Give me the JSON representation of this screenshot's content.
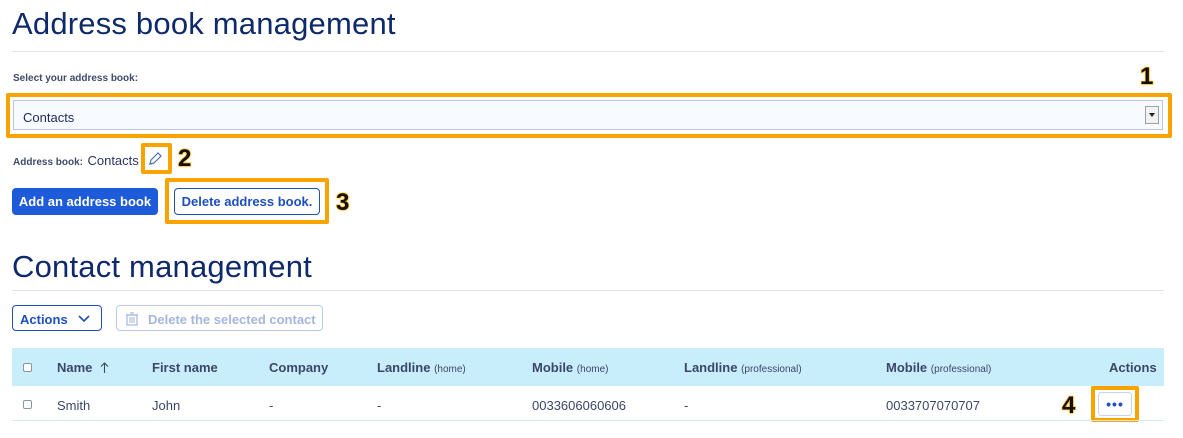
{
  "page": {
    "title": "Address book management",
    "select_label": "Select your address book:",
    "selected_book": "Contacts",
    "address_book_label": "Address book:",
    "address_book_name": "Contacts",
    "add_button": "Add an address book",
    "delete_button": "Delete address book."
  },
  "contacts": {
    "title": "Contact management",
    "actions_button": "Actions",
    "delete_selected_button": "Delete the selected contact",
    "columns": {
      "name": "Name",
      "first_name": "First name",
      "company": "Company",
      "landline_home": "Landline",
      "landline_home_sub": "(home)",
      "mobile_home": "Mobile",
      "mobile_home_sub": "(home)",
      "landline_pro": "Landline",
      "landline_pro_sub": "(professional)",
      "mobile_pro": "Mobile",
      "mobile_pro_sub": "(professional)",
      "actions": "Actions"
    },
    "rows": [
      {
        "name": "Smith",
        "first_name": "John",
        "company": "-",
        "landline_home": "-",
        "mobile_home": "0033606060606",
        "landline_pro": "-",
        "mobile_pro": "0033707070707",
        "more": "•••"
      }
    ]
  },
  "callouts": [
    "1",
    "2",
    "3",
    "4"
  ],
  "colors": {
    "primary": "#1e5bd8",
    "highlight": "#f7a300",
    "table_header": "#c9eefb",
    "heading": "#0f2a6b"
  },
  "icons": {
    "edit": "pencil-icon",
    "dropdown": "chevron-down-icon",
    "sort": "arrow-up-icon",
    "trash": "trash-icon",
    "select_arrow": "caret-down-icon"
  }
}
